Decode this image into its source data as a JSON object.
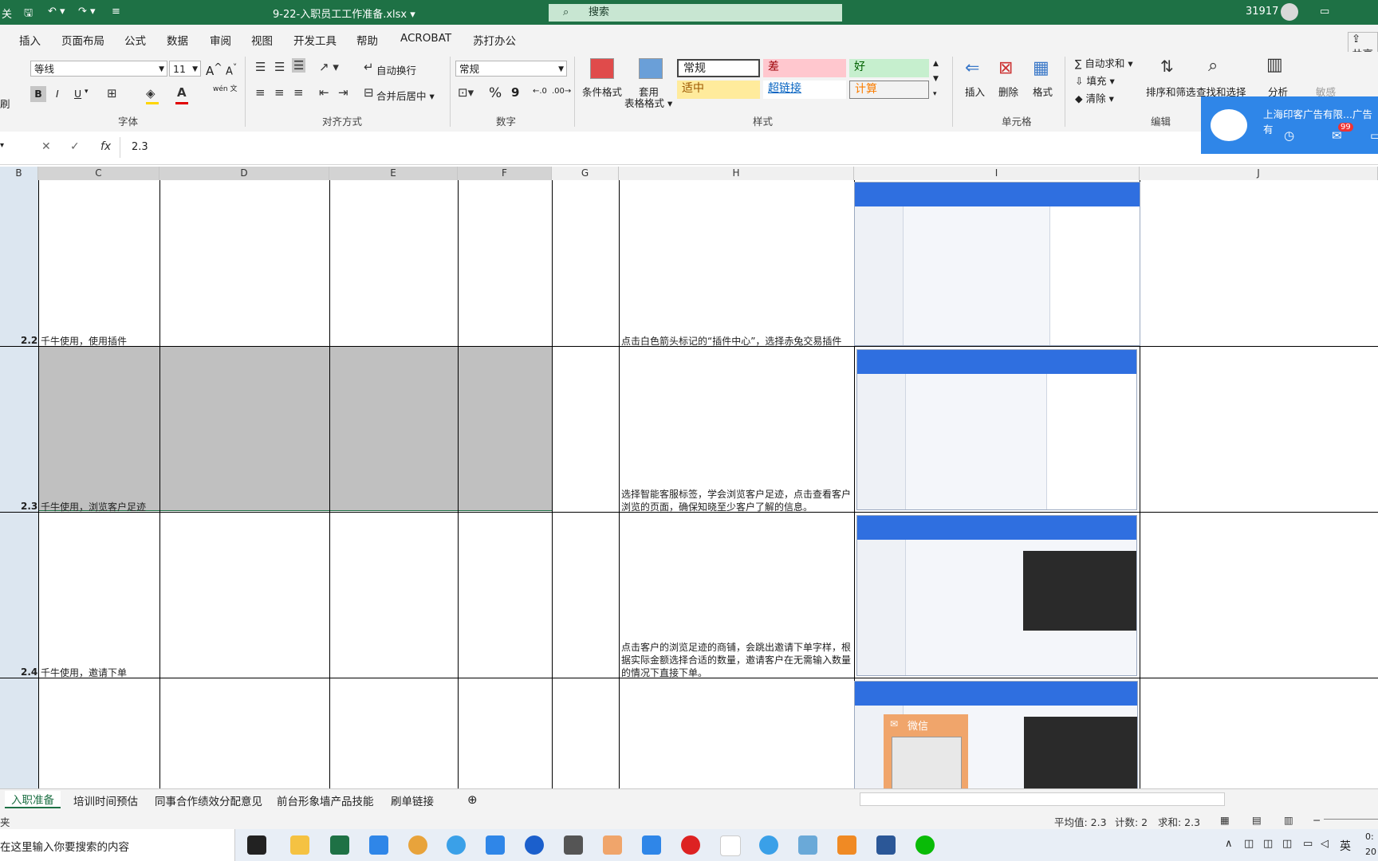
{
  "window": {
    "filename": "9-22-入职员工工作准备.xlsx",
    "search_placeholder": "搜索",
    "user_id": "31917",
    "left_partial": "关"
  },
  "menu": [
    "插入",
    "页面布局",
    "公式",
    "数据",
    "审阅",
    "视图",
    "开发工具",
    "帮助",
    "ACROBAT",
    "苏打办公"
  ],
  "share_label": "共享",
  "ribbon": {
    "font_name": "等线",
    "font_size": "11",
    "inc_font": "A",
    "dec_font": "A",
    "bold": "B",
    "italic": "I",
    "underline": "U",
    "phonetic": "wén 文",
    "wrap_text": "自动换行",
    "merge_center": "合并后居中",
    "number_format": "常规",
    "percent": "%",
    "comma": "9",
    "cond_format": "条件格式",
    "table_format_1": "套用",
    "table_format_2": "表格格式",
    "styles": {
      "normal": "常规",
      "bad": "差",
      "good": "好",
      "neutral": "适中",
      "hyperlink": "超链接",
      "calc": "计算"
    },
    "insert": "插入",
    "delete": "删除",
    "format": "格式",
    "autosum": "自动求和",
    "fill": "填充",
    "clear": "清除",
    "sort_filter": "排序和筛选",
    "find_select": "查找和选择",
    "analyze": "分析",
    "sensitivity": "敏感",
    "groups": {
      "font": "字体",
      "alignment": "对齐方式",
      "number": "数字",
      "styles": "样式",
      "cells": "单元格",
      "editing": "编辑"
    },
    "left_partial": "刷"
  },
  "formula_bar": {
    "value": "2.3",
    "fx": "fx"
  },
  "columns": [
    "B",
    "C",
    "D",
    "E",
    "F",
    "G",
    "H",
    "I",
    "J"
  ],
  "rows": [
    {
      "num": "2.2",
      "task": "千牛使用，使用插件",
      "desc": "点击白色箭头标记的“插件中心”，选择赤兔交易插件"
    },
    {
      "num": "2.3",
      "task": "千牛使用，浏览客户足迹",
      "desc": "选择智能客服标签，学会浏览客户足迹，点击查看客户浏览的页面，确保知晓至少客户了解的信息。"
    },
    {
      "num": "2.4",
      "task": "千牛使用，邀请下单",
      "desc": "点击客户的浏览足迹的商铺，会跳出邀请下单字样，根据实际金额选择合适的数量，邀请客户在无需输入数量的情况下直接下单。"
    }
  ],
  "wechat_popup": "微信",
  "notification": {
    "title": "上海印客广告有限...广告有",
    "badge": "99"
  },
  "sheet_tabs": [
    "入职准备",
    "培训时间预估",
    "同事合作绩效分配意见",
    "前台形象墙产品技能",
    "刷单链接"
  ],
  "status": {
    "left_partial": "夹",
    "average": "平均值: 2.3",
    "count": "计数: 2",
    "sum": "求和: 2.3"
  },
  "taskbar": {
    "search_text": "在这里输入你要搜索的内容",
    "ime": "英",
    "clock_partial_1": "0:",
    "clock_partial_2": "20"
  },
  "colors": {
    "excel_green": "#1e7145",
    "ribbon_bg": "#f3f3f3",
    "style_bad_bg": "#ffc7ce",
    "style_good_bg": "#c6efce",
    "style_neutral_bg": "#ffeb9c",
    "wechat_orange": "#f0a56b"
  }
}
